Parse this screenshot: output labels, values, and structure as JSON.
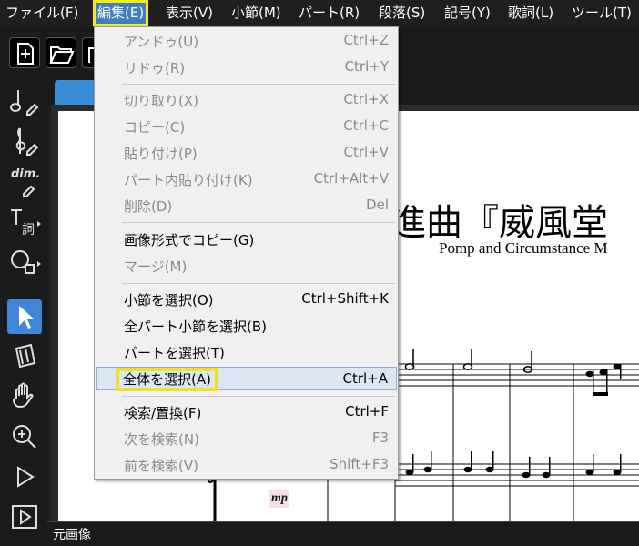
{
  "menubar": {
    "items": [
      {
        "label": "ファイル(F)"
      },
      {
        "label": "編集(E)"
      },
      {
        "label": "表示(V)"
      },
      {
        "label": "小節(M)"
      },
      {
        "label": "パート(R)"
      },
      {
        "label": "段落(S)"
      },
      {
        "label": "記号(Y)"
      },
      {
        "label": "歌詞(L)"
      },
      {
        "label": "ツール(T)"
      }
    ]
  },
  "edit_menu": {
    "items": [
      {
        "label": "アンドゥ(U)",
        "shortcut": "Ctrl+Z"
      },
      {
        "label": "リドゥ(R)",
        "shortcut": "Ctrl+Y"
      },
      {
        "label": "切り取り(X)",
        "shortcut": "Ctrl+X"
      },
      {
        "label": "コピー(C)",
        "shortcut": "Ctrl+C"
      },
      {
        "label": "貼り付け(P)",
        "shortcut": "Ctrl+V"
      },
      {
        "label": "パート内貼り付け(K)",
        "shortcut": "Ctrl+Alt+V"
      },
      {
        "label": "削除(D)",
        "shortcut": "Del"
      },
      {
        "label": "画像形式でコピー(G)",
        "shortcut": ""
      },
      {
        "label": "マージ(M)",
        "shortcut": ""
      },
      {
        "label": "小節を選択(O)",
        "shortcut": "Ctrl+Shift+K"
      },
      {
        "label": "全パート小節を選択(B)",
        "shortcut": ""
      },
      {
        "label": "パートを選択(T)",
        "shortcut": ""
      },
      {
        "label": "全体を選択(A)",
        "shortcut": "Ctrl+A"
      },
      {
        "label": "検索/置換(F)",
        "shortcut": "Ctrl+F"
      },
      {
        "label": "次を検索(N)",
        "shortcut": "F3"
      },
      {
        "label": "前を検索(V)",
        "shortcut": "Shift+F3"
      }
    ]
  },
  "tools": {
    "dim_label": "dim.",
    "lyrics_label": "詞"
  },
  "score": {
    "title": "進曲『威風堂",
    "subtitle": "Pomp and Circumstance M",
    "dynamic": "mp"
  },
  "statusbar": {
    "text": "元画像"
  },
  "colors": {
    "accent": "#3f86d6",
    "highlight_frame": "#f4ea1e",
    "menu_highlight": "#dce7f3"
  }
}
